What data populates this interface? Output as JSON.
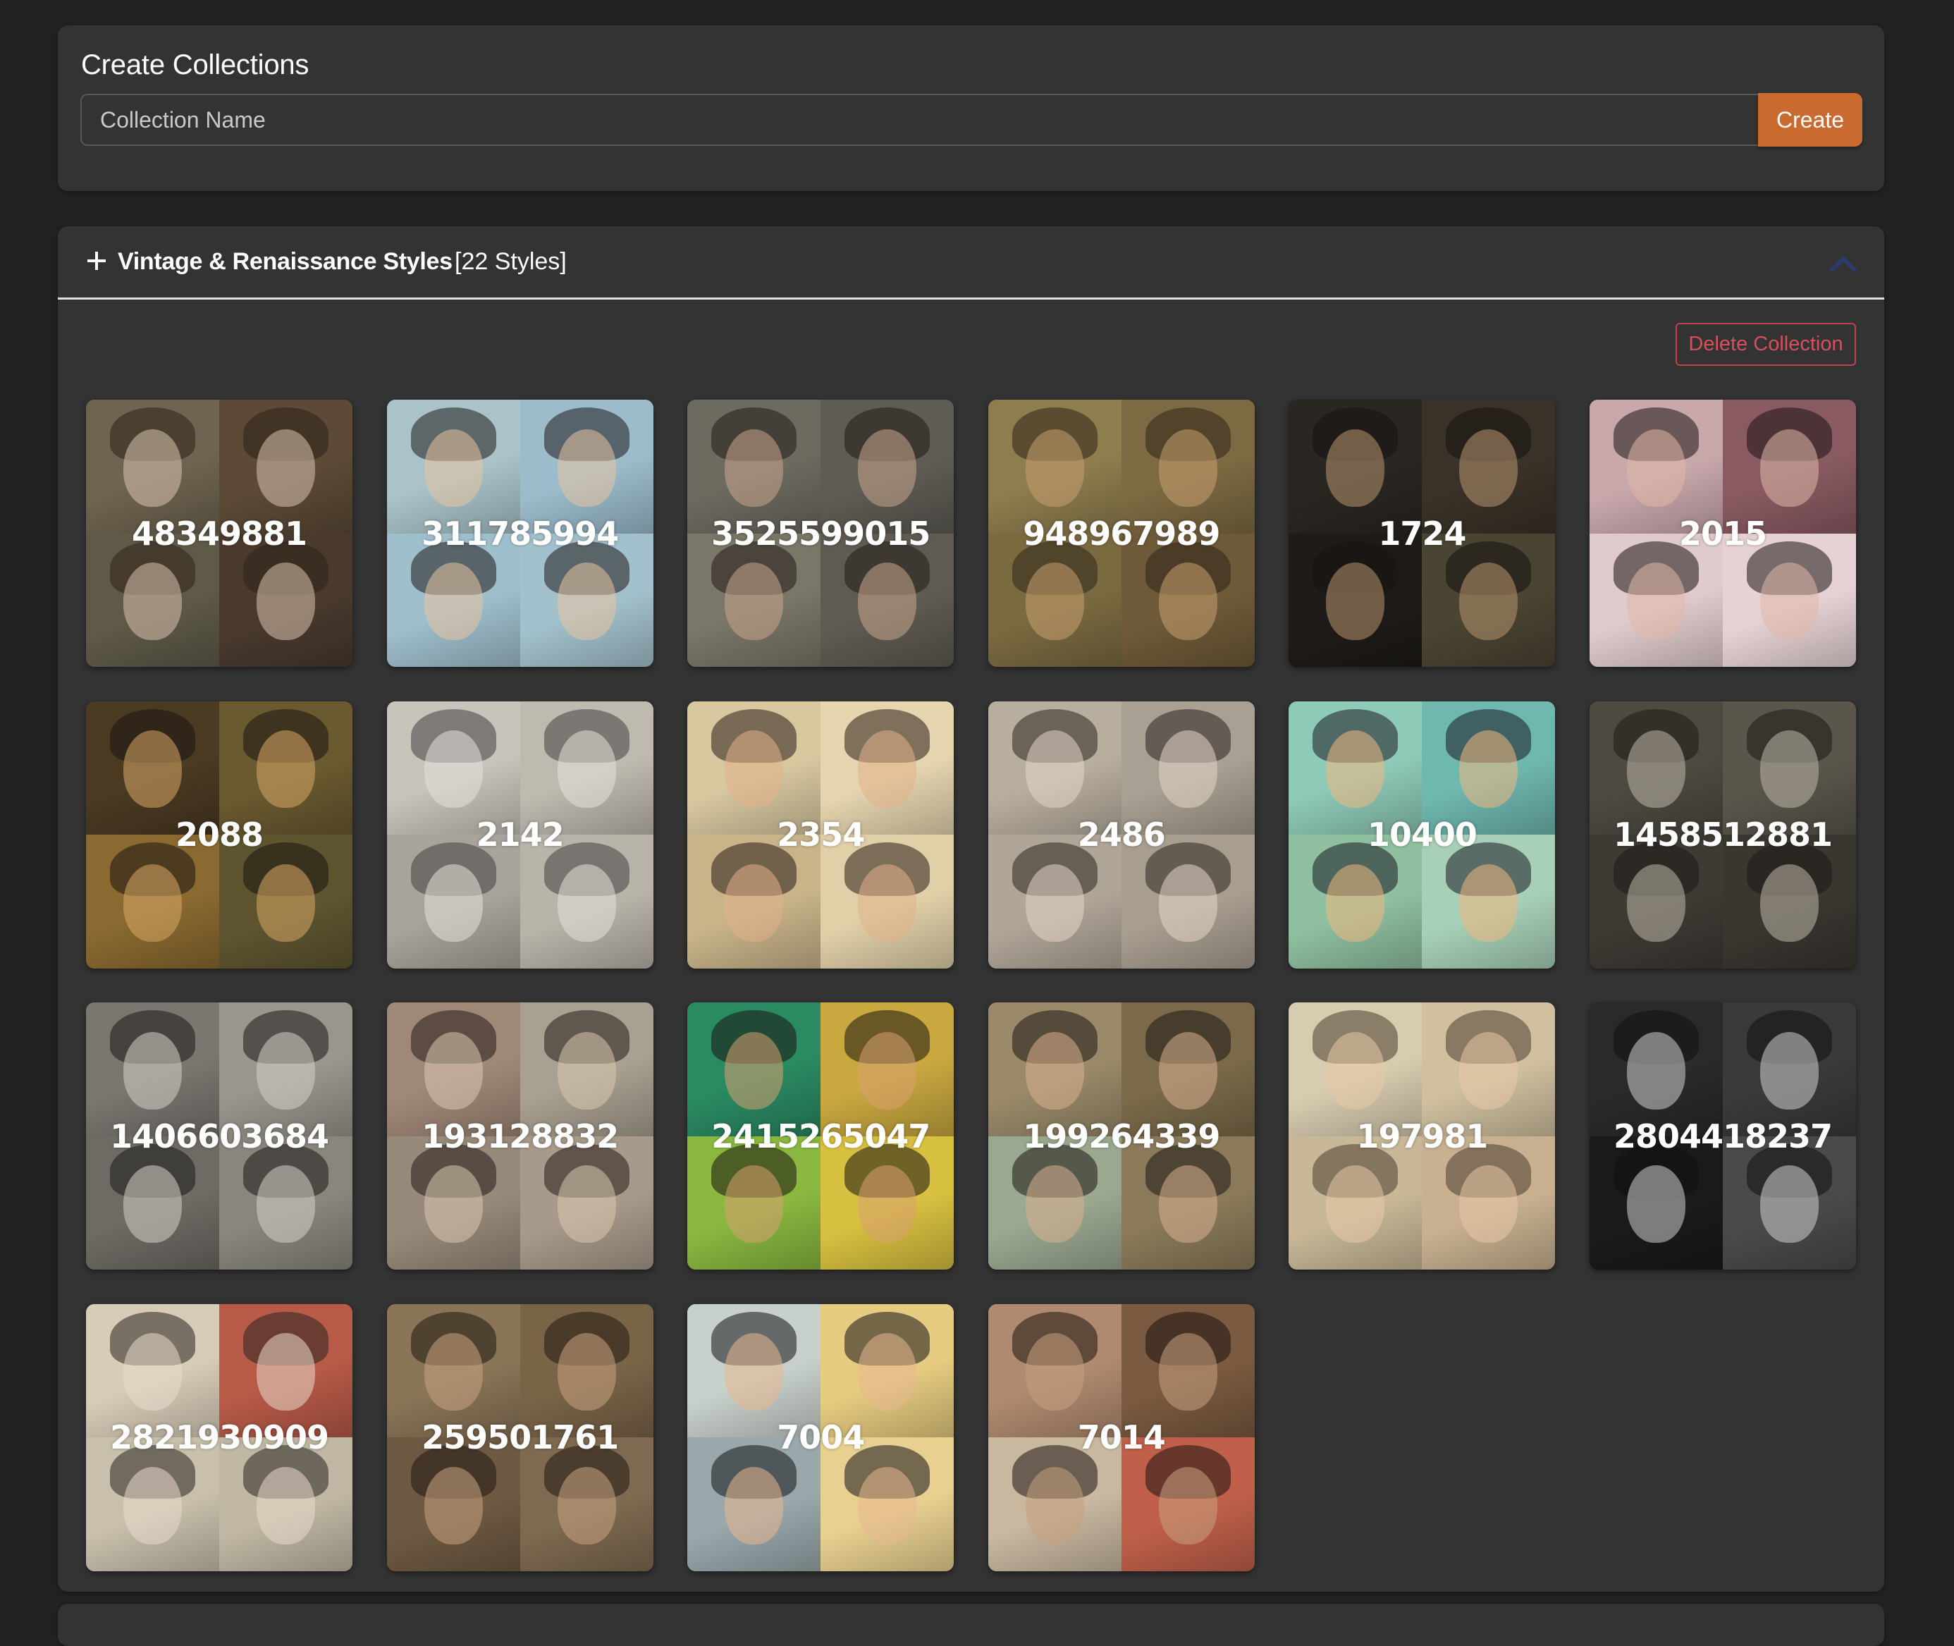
{
  "create_section": {
    "title": "Create Collections",
    "input_value": "",
    "input_placeholder": "Collection Name",
    "create_label": "Create",
    "accent_color": "#c96a2e"
  },
  "collection": {
    "expand_icon": "plus-icon",
    "title": "Vintage & Renaissance Styles",
    "count_label": "[22 Styles]",
    "collapse_icon": "chevron-up-icon",
    "delete_label": "Delete Collection",
    "delete_color": "#d6505c",
    "styles": [
      {
        "label": "48349881",
        "colors": [
          "#6e6450",
          "#5c4a36",
          "#5f5a48",
          "#4a3a2e"
        ],
        "face": "#d9c2ae",
        "hair": "#2e2218"
      },
      {
        "label": "311785994",
        "colors": [
          "#a9c3c9",
          "#9cbccc",
          "#9fbfcc",
          "#a3c1cc"
        ],
        "face": "#e8c5a0",
        "hair": "#1f1a1a"
      },
      {
        "label": "3525599015",
        "colors": [
          "#6d6a60",
          "#5f5c55",
          "#7a7668",
          "#5f5b52"
        ],
        "face": "#c9a58c",
        "hair": "#221c18"
      },
      {
        "label": "948967989",
        "colors": [
          "#8e7d4e",
          "#7c6a42",
          "#7a6a40",
          "#6e5a38"
        ],
        "face": "#c9a070",
        "hair": "#2e2418"
      },
      {
        "label": "1724",
        "colors": [
          "#2a2622",
          "#3a3228",
          "#1e1b18",
          "#4a4432"
        ],
        "face": "#b89670",
        "hair": "#151210"
      },
      {
        "label": "2015",
        "colors": [
          "#c9a8ac",
          "#8a5a62",
          "#e0cbcc",
          "#e6d2d4"
        ],
        "face": "#e0b8a8",
        "hair": "#1b1414"
      },
      {
        "label": "2088",
        "colors": [
          "#4a3a22",
          "#6a5a30",
          "#8a6a30",
          "#5e5530"
        ],
        "face": "#d9a866",
        "hair": "#1a1410"
      },
      {
        "label": "2142",
        "colors": [
          "#c8c4bc",
          "#bfbab0",
          "#a8a49c",
          "#b9b4aa"
        ],
        "face": "#e6e2da",
        "hair": "#444040"
      },
      {
        "label": "2354",
        "colors": [
          "#d8c8a0",
          "#e6d6b0",
          "#c9b48a",
          "#e0d0a8"
        ],
        "face": "#e2b08a",
        "hair": "#2a1e16"
      },
      {
        "label": "2486",
        "colors": [
          "#b8ae9e",
          "#a8a092",
          "#b0a698",
          "#a89e90"
        ],
        "face": "#e6d6c8",
        "hair": "#2c2420"
      },
      {
        "label": "10400",
        "colors": [
          "#8ecab8",
          "#6fb8b0",
          "#8fc0a0",
          "#a8d0b8"
        ],
        "face": "#f0b880",
        "hair": "#1a1a22"
      },
      {
        "label": "1458512881",
        "colors": [
          "#4e4a42",
          "#5a564c",
          "#3e3a34",
          "#3a3630"
        ],
        "face": "#bdb6a8",
        "hair": "#1e1c18"
      },
      {
        "label": "1406603684",
        "colors": [
          "#7a7670",
          "#9a968e",
          "#6e6a64",
          "#8a867e"
        ],
        "face": "#d6d0c8",
        "hair": "#1c1a18"
      },
      {
        "label": "193128832",
        "colors": [
          "#a08878",
          "#a8a090",
          "#988a7a",
          "#a89a8a"
        ],
        "face": "#d8c8b0",
        "hair": "#241c18"
      },
      {
        "label": "2415265047",
        "colors": [
          "#2a8a62",
          "#c9a840",
          "#8ab840",
          "#d8c040"
        ],
        "face": "#d8a070",
        "hair": "#1a1410"
      },
      {
        "label": "199264339",
        "colors": [
          "#9a8a6a",
          "#7a6a4a",
          "#9aa890",
          "#8a7a5a"
        ],
        "face": "#d8b090",
        "hair": "#1c1814"
      },
      {
        "label": "197981",
        "colors": [
          "#d8ccb0",
          "#d0c0a0",
          "#c8b898",
          "#c8b090"
        ],
        "face": "#e8c8a8",
        "hair": "#4a3e30"
      },
      {
        "label": "2804418237",
        "colors": [
          "#2a2a2a",
          "#3a3a3a",
          "#1a1a1a",
          "#4a4a4a"
        ],
        "face": "#d0d0d0",
        "hair": "#101010"
      },
      {
        "label": "2821930909",
        "colors": [
          "#d8ccb8",
          "#b85a48",
          "#c8c0ac",
          "#c0b8a4"
        ],
        "face": "#eadacc",
        "hair": "#2a2420"
      },
      {
        "label": "259501761",
        "colors": [
          "#8a7558",
          "#7a6448",
          "#6e5a42",
          "#7e6a50"
        ],
        "face": "#c9a482",
        "hair": "#201812"
      },
      {
        "label": "7004",
        "colors": [
          "#c8d0cc",
          "#e6cc80",
          "#9aa8ac",
          "#e8d090"
        ],
        "face": "#e8b890",
        "hair": "#141418"
      },
      {
        "label": "7014",
        "colors": [
          "#b08a70",
          "#7a5a40",
          "#c8b8a0",
          "#c0604a"
        ],
        "face": "#c9a080",
        "hair": "#1c1410"
      }
    ]
  }
}
